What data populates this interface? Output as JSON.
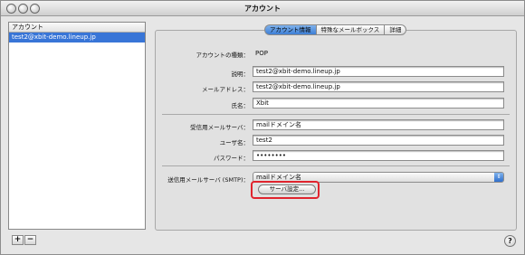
{
  "window": {
    "title": "アカウント"
  },
  "sidebar": {
    "header": "アカウント",
    "items": [
      {
        "label": "test2@xbit-demo.lineup.jp"
      }
    ],
    "add_label": "+",
    "remove_label": "−"
  },
  "tabs": [
    {
      "label": "アカウント情報",
      "active": true
    },
    {
      "label": "特殊なメールボックス",
      "active": false
    },
    {
      "label": "詳細",
      "active": false
    }
  ],
  "form": {
    "account_type_label": "アカウントの種類：",
    "account_type_value": "POP",
    "description_label": "説明：",
    "description_value": "test2@xbit-demo.lineup.jp",
    "email_label": "メールアドレス：",
    "email_value": "test2@xbit-demo.lineup.jp",
    "name_label": "氏名：",
    "name_value": "Xbit",
    "incoming_label": "受信用メールサーバ：",
    "incoming_value": "mailドメイン名",
    "username_label": "ユーザ名：",
    "username_value": "test2",
    "password_label": "パスワード：",
    "password_value": "••••••••",
    "smtp_label": "送信用メールサーバ (SMTP)：",
    "smtp_value": "mailドメイン名",
    "server_settings_label": "サーバ設定..."
  },
  "help_label": "?",
  "colors": {
    "selection": "#3875d7",
    "highlight": "#e0242e"
  }
}
